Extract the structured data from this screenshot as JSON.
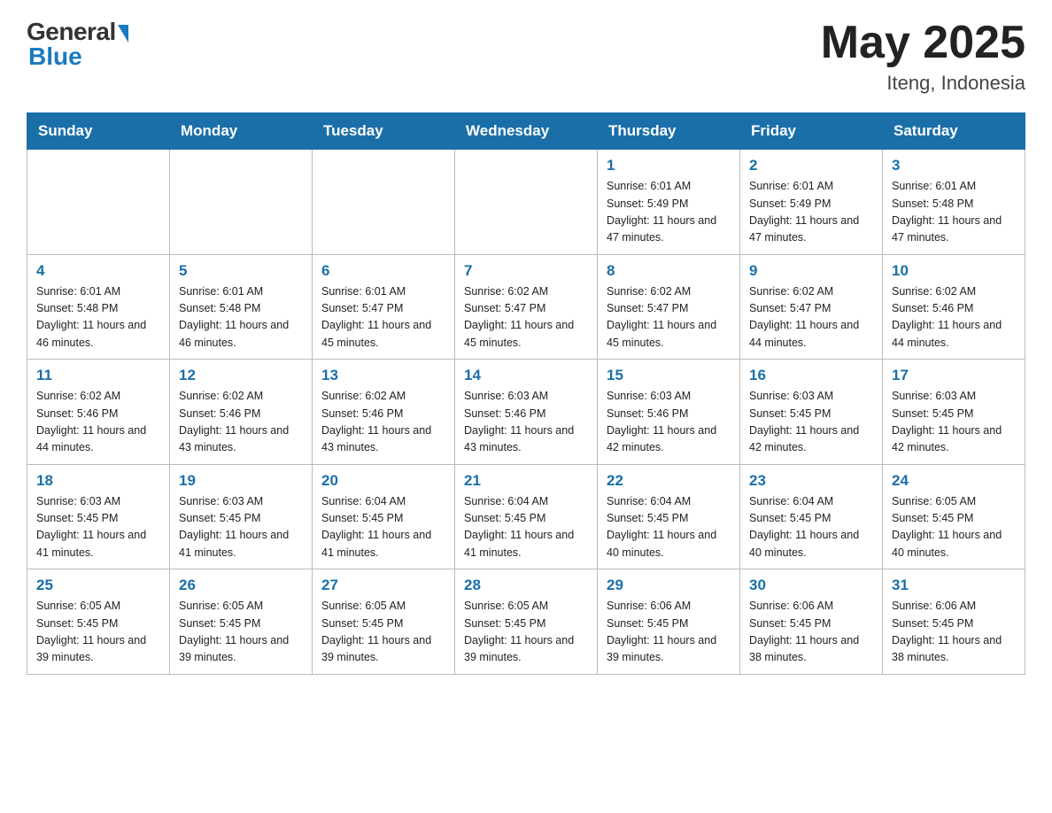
{
  "header": {
    "logo_general": "General",
    "logo_blue": "Blue",
    "month_year": "May 2025",
    "location": "Iteng, Indonesia"
  },
  "days_of_week": [
    "Sunday",
    "Monday",
    "Tuesday",
    "Wednesday",
    "Thursday",
    "Friday",
    "Saturday"
  ],
  "weeks": [
    [
      {
        "day": "",
        "info": ""
      },
      {
        "day": "",
        "info": ""
      },
      {
        "day": "",
        "info": ""
      },
      {
        "day": "",
        "info": ""
      },
      {
        "day": "1",
        "info": "Sunrise: 6:01 AM\nSunset: 5:49 PM\nDaylight: 11 hours and 47 minutes."
      },
      {
        "day": "2",
        "info": "Sunrise: 6:01 AM\nSunset: 5:49 PM\nDaylight: 11 hours and 47 minutes."
      },
      {
        "day": "3",
        "info": "Sunrise: 6:01 AM\nSunset: 5:48 PM\nDaylight: 11 hours and 47 minutes."
      }
    ],
    [
      {
        "day": "4",
        "info": "Sunrise: 6:01 AM\nSunset: 5:48 PM\nDaylight: 11 hours and 46 minutes."
      },
      {
        "day": "5",
        "info": "Sunrise: 6:01 AM\nSunset: 5:48 PM\nDaylight: 11 hours and 46 minutes."
      },
      {
        "day": "6",
        "info": "Sunrise: 6:01 AM\nSunset: 5:47 PM\nDaylight: 11 hours and 45 minutes."
      },
      {
        "day": "7",
        "info": "Sunrise: 6:02 AM\nSunset: 5:47 PM\nDaylight: 11 hours and 45 minutes."
      },
      {
        "day": "8",
        "info": "Sunrise: 6:02 AM\nSunset: 5:47 PM\nDaylight: 11 hours and 45 minutes."
      },
      {
        "day": "9",
        "info": "Sunrise: 6:02 AM\nSunset: 5:47 PM\nDaylight: 11 hours and 44 minutes."
      },
      {
        "day": "10",
        "info": "Sunrise: 6:02 AM\nSunset: 5:46 PM\nDaylight: 11 hours and 44 minutes."
      }
    ],
    [
      {
        "day": "11",
        "info": "Sunrise: 6:02 AM\nSunset: 5:46 PM\nDaylight: 11 hours and 44 minutes."
      },
      {
        "day": "12",
        "info": "Sunrise: 6:02 AM\nSunset: 5:46 PM\nDaylight: 11 hours and 43 minutes."
      },
      {
        "day": "13",
        "info": "Sunrise: 6:02 AM\nSunset: 5:46 PM\nDaylight: 11 hours and 43 minutes."
      },
      {
        "day": "14",
        "info": "Sunrise: 6:03 AM\nSunset: 5:46 PM\nDaylight: 11 hours and 43 minutes."
      },
      {
        "day": "15",
        "info": "Sunrise: 6:03 AM\nSunset: 5:46 PM\nDaylight: 11 hours and 42 minutes."
      },
      {
        "day": "16",
        "info": "Sunrise: 6:03 AM\nSunset: 5:45 PM\nDaylight: 11 hours and 42 minutes."
      },
      {
        "day": "17",
        "info": "Sunrise: 6:03 AM\nSunset: 5:45 PM\nDaylight: 11 hours and 42 minutes."
      }
    ],
    [
      {
        "day": "18",
        "info": "Sunrise: 6:03 AM\nSunset: 5:45 PM\nDaylight: 11 hours and 41 minutes."
      },
      {
        "day": "19",
        "info": "Sunrise: 6:03 AM\nSunset: 5:45 PM\nDaylight: 11 hours and 41 minutes."
      },
      {
        "day": "20",
        "info": "Sunrise: 6:04 AM\nSunset: 5:45 PM\nDaylight: 11 hours and 41 minutes."
      },
      {
        "day": "21",
        "info": "Sunrise: 6:04 AM\nSunset: 5:45 PM\nDaylight: 11 hours and 41 minutes."
      },
      {
        "day": "22",
        "info": "Sunrise: 6:04 AM\nSunset: 5:45 PM\nDaylight: 11 hours and 40 minutes."
      },
      {
        "day": "23",
        "info": "Sunrise: 6:04 AM\nSunset: 5:45 PM\nDaylight: 11 hours and 40 minutes."
      },
      {
        "day": "24",
        "info": "Sunrise: 6:05 AM\nSunset: 5:45 PM\nDaylight: 11 hours and 40 minutes."
      }
    ],
    [
      {
        "day": "25",
        "info": "Sunrise: 6:05 AM\nSunset: 5:45 PM\nDaylight: 11 hours and 39 minutes."
      },
      {
        "day": "26",
        "info": "Sunrise: 6:05 AM\nSunset: 5:45 PM\nDaylight: 11 hours and 39 minutes."
      },
      {
        "day": "27",
        "info": "Sunrise: 6:05 AM\nSunset: 5:45 PM\nDaylight: 11 hours and 39 minutes."
      },
      {
        "day": "28",
        "info": "Sunrise: 6:05 AM\nSunset: 5:45 PM\nDaylight: 11 hours and 39 minutes."
      },
      {
        "day": "29",
        "info": "Sunrise: 6:06 AM\nSunset: 5:45 PM\nDaylight: 11 hours and 39 minutes."
      },
      {
        "day": "30",
        "info": "Sunrise: 6:06 AM\nSunset: 5:45 PM\nDaylight: 11 hours and 38 minutes."
      },
      {
        "day": "31",
        "info": "Sunrise: 6:06 AM\nSunset: 5:45 PM\nDaylight: 11 hours and 38 minutes."
      }
    ]
  ]
}
